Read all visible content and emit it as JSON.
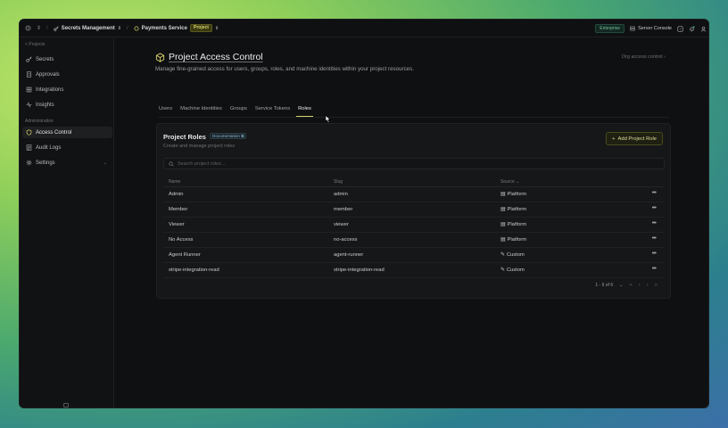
{
  "topbar": {
    "org_name": "Secrets Management",
    "project_name": "Payments Service",
    "project_badge": "Project",
    "plan_badge": "Enterprise",
    "server_console": "Server Console"
  },
  "sidebar": {
    "back_label": "< Projects",
    "items_top": [
      {
        "label": "Secrets",
        "icon": "key-icon"
      },
      {
        "label": "Approvals",
        "icon": "document-icon"
      },
      {
        "label": "Integrations",
        "icon": "puzzle-icon"
      },
      {
        "label": "Insights",
        "icon": "pulse-icon"
      }
    ],
    "section_label": "Administration",
    "items_admin": [
      {
        "label": "Access Control",
        "icon": "shield-icon",
        "active": true
      },
      {
        "label": "Audit Logs",
        "icon": "list-icon"
      },
      {
        "label": "Settings",
        "icon": "gear-icon"
      }
    ]
  },
  "page": {
    "title": "Project Access Control",
    "description": "Manage fine-grained access for users, groups, roles, and machine identities within your project resources.",
    "org_link": "Org access control",
    "tabs": [
      "Users",
      "Machine Identities",
      "Groups",
      "Service Tokens",
      "Roles"
    ],
    "active_tab": "Roles"
  },
  "card": {
    "title": "Project Roles",
    "doc_badge": "Documentation",
    "subtitle": "Create and manage project roles",
    "add_button": "Add Project Role",
    "search_placeholder": "Search project roles...",
    "columns": [
      "Name",
      "Slug",
      "Source"
    ],
    "rows": [
      {
        "name": "Admin",
        "slug": "admin",
        "source": "Platform"
      },
      {
        "name": "Member",
        "slug": "member",
        "source": "Platform"
      },
      {
        "name": "Viewer",
        "slug": "viewer",
        "source": "Platform"
      },
      {
        "name": "No Access",
        "slug": "no-access",
        "source": "Platform"
      },
      {
        "name": "Agent Runner",
        "slug": "agent-runner",
        "source": "Custom"
      },
      {
        "name": "stripe-integration-read",
        "slug": "stripe-integration-read",
        "source": "Custom"
      }
    ],
    "pagination": "1 - 6 of 6"
  },
  "colors": {
    "accent": "#d6d16a",
    "background": "#0f1011",
    "card": "#161718"
  }
}
